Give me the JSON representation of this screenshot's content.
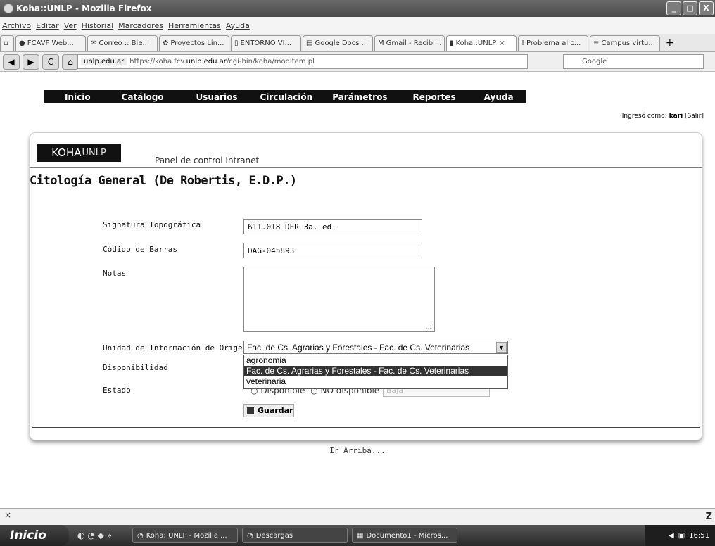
{
  "window": {
    "title": "Koha::UNLP - Mozilla Firefox",
    "buttons": [
      "_",
      "□",
      "X"
    ]
  },
  "menubar": [
    "Archivo",
    "Editar",
    "Ver",
    "Historial",
    "Marcadores",
    "Herramientas",
    "Ayuda"
  ],
  "tabs": [
    "FCAVF Web...",
    "Correo :: Bie...",
    "Proyectos Lin...",
    "ENTORNO VI...",
    "Google Docs ...",
    "Gmail - Recibi...",
    "Koha::UNLP",
    "Problema al c...",
    "Campus virtu..."
  ],
  "nav": {
    "site": "unlp.edu.ar",
    "url_prefix": "https://koha.fcv.",
    "url_domain": "unlp.edu.ar",
    "url_path": "/cgi-bin/koha/moditem.pl",
    "search_engine": "Google"
  },
  "koha_menu": [
    "Inicio",
    "Catálogo",
    "Usuarios",
    "Circulación",
    "Parámetros",
    "Reportes",
    "Ayuda"
  ],
  "logged_in": {
    "prefix": "Ingresó como:",
    "user": "kari",
    "logout": "[Salir]"
  },
  "logo": {
    "main": "KOHA",
    "sub": "UNLP"
  },
  "panel_title": "Panel de control Intranet",
  "book_title": "Citología General (De Robertis, E.D.P.)",
  "form": {
    "signatura_label": "Signatura Topográfica",
    "signatura_value": "611.018 DER 3a. ed.",
    "codigo_label": "Código de Barras",
    "codigo_value": "DAG-045893",
    "notas_label": "Notas",
    "unidad_label": "Unidad de Información de Origen",
    "unidad_selected": "Fac. de Cs. Agrarias y Forestales - Fac. de Cs. Veterinarias",
    "unidad_options": [
      "agronomia",
      "Fac. de Cs. Agrarias y Forestales - Fac. de Cs. Veterinarias",
      "veterinaria"
    ],
    "disponibilidad_label": "Disponibilidad",
    "estado_label": "Estado",
    "radio_disponible": "Disponible",
    "radio_no_disponible": "NO disponible",
    "estado_value": "Baja",
    "save_label": "Guardar"
  },
  "ir_arriba": "Ir Arriba...",
  "findbar": {
    "close": "×",
    "letter": "Z"
  },
  "taskbar": {
    "start": "Inicio",
    "items": [
      "Koha::UNLP - Mozilla ...",
      "Descargas",
      "Documento1 - Micros..."
    ],
    "clock": "16:51"
  }
}
